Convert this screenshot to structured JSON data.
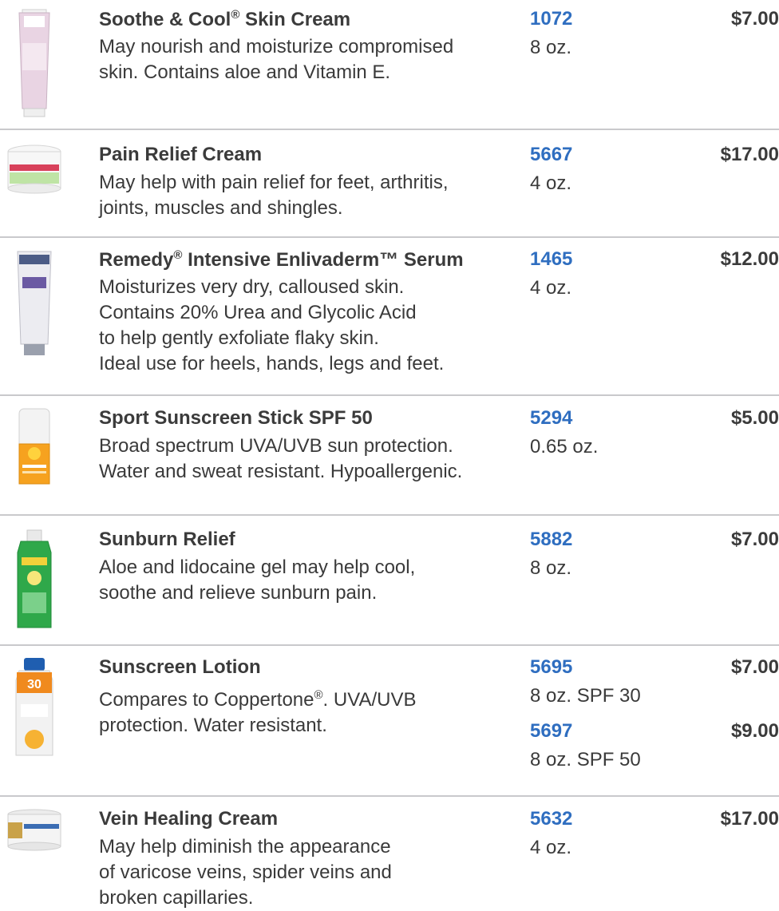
{
  "products": [
    {
      "name": "Soothe & Cool",
      "name_mark": "®",
      "name_suffix": " Skin Cream",
      "desc_lines": [
        "May nourish and moisturize compromised",
        "skin. Contains aloe and Vitamin E."
      ],
      "image": "soothe-cool-tube-image",
      "variants": [
        {
          "sku": "1072",
          "size": "8 oz.",
          "price": "$7.00"
        }
      ]
    },
    {
      "name": "Pain Relief Cream",
      "desc_lines": [
        "May help with pain relief for feet, arthritis,",
        "joints, muscles and shingles."
      ],
      "image": "pain-relief-jar-image",
      "variants": [
        {
          "sku": "5667",
          "size": "4 oz.",
          "price": "$17.00"
        }
      ]
    },
    {
      "name": "Remedy",
      "name_mark": "®",
      "name_suffix": " Intensive Enlivaderm™ Serum",
      "desc_lines": [
        "Moisturizes very dry, calloused skin.",
        "Contains 20% Urea and Glycolic Acid",
        "to help gently exfoliate flaky skin.",
        "Ideal use for heels, hands, legs and feet."
      ],
      "image": "remedy-tube-image",
      "variants": [
        {
          "sku": "1465",
          "size": "4 oz.",
          "price": "$12.00"
        }
      ]
    },
    {
      "name": "Sport Sunscreen Stick SPF 50",
      "desc_lines": [
        "Broad spectrum UVA/UVB sun protection.",
        "Water and sweat resistant. Hypoallergenic."
      ],
      "image": "sunscreen-stick-image",
      "variants": [
        {
          "sku": "5294",
          "size": "0.65 oz.",
          "price": "$5.00"
        }
      ]
    },
    {
      "name": "Sunburn Relief",
      "desc_lines": [
        "Aloe and lidocaine gel may help cool,",
        "soothe and relieve sunburn pain."
      ],
      "image": "aloe-gel-bottle-image",
      "variants": [
        {
          "sku": "5882",
          "size": "8 oz.",
          "price": "$7.00"
        }
      ]
    },
    {
      "name": "Sunscreen Lotion",
      "desc_line1_pre": "Compares to Coppertone",
      "desc_line1_mark": "®",
      "desc_line1_post": ". UVA/UVB",
      "desc_line2": "protection. Water resistant.",
      "image": "sunscreen-lotion-bottle-image",
      "variants": [
        {
          "sku": "5695",
          "size": "8 oz. SPF 30",
          "price": "$7.00"
        },
        {
          "sku": "5697",
          "size": "8 oz. SPF 50",
          "price": "$9.00"
        }
      ]
    },
    {
      "name": "Vein Healing Cream",
      "desc_lines": [
        "May help diminish the appearance",
        "of varicose veins, spider veins and",
        "broken capillaries."
      ],
      "image": "vein-cream-jar-image",
      "variants": [
        {
          "sku": "5632",
          "size": "4 oz.",
          "price": "$17.00"
        }
      ]
    }
  ]
}
